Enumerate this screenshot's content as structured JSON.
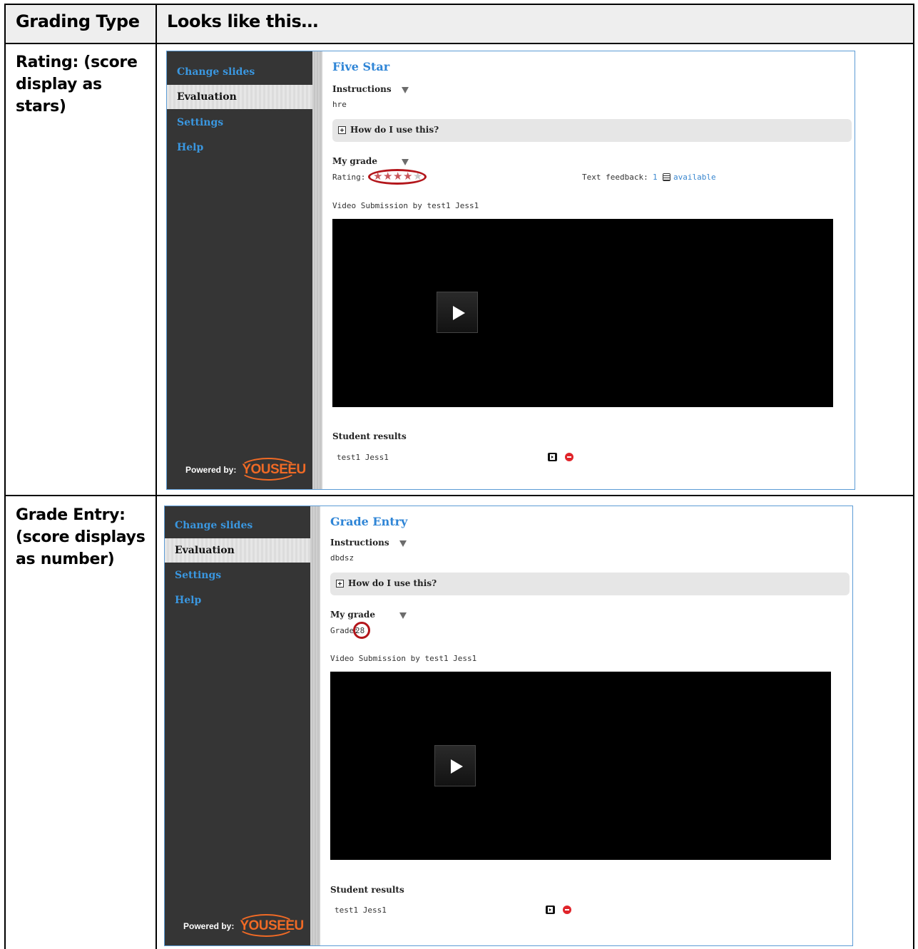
{
  "table": {
    "headers": [
      "Grading Type",
      "Looks like this…"
    ],
    "rows": [
      {
        "label": "Rating: (score display as stars)",
        "app": {
          "sidebar": [
            "Change slides",
            "Evaluation",
            "Settings",
            "Help"
          ],
          "active_index": 1,
          "powered_by": "Powered by:",
          "logo": "YOUSEEU",
          "title": "Five Star",
          "instructions_label": "Instructions",
          "instructions_text": "hre",
          "howto": "How do I use this?",
          "my_grade_label": "My grade",
          "grade_prefix": "Rating:",
          "rating": {
            "filled": 4,
            "max": 5
          },
          "feedback_label": "Text feedback:",
          "feedback_count": "1",
          "feedback_link": "available",
          "video_caption": "Video Submission by test1 Jess1",
          "results_label": "Student results",
          "result_name": "test1 Jess1"
        }
      },
      {
        "label": "Grade Entry: (score displays as number)",
        "app": {
          "sidebar": [
            "Change slides",
            "Evaluation",
            "Settings",
            "Help"
          ],
          "active_index": 1,
          "powered_by": "Powered by:",
          "logo": "YOUSEEU",
          "title": "Grade Entry",
          "instructions_label": "Instructions",
          "instructions_text": "dbdsz",
          "howto": "How do I use this?",
          "my_grade_label": "My grade",
          "grade_prefix": "Grade:",
          "grade_value": "28",
          "video_caption": "Video Submission by test1 Jess1",
          "results_label": "Student results",
          "result_name": "test1 Jess1"
        }
      }
    ]
  },
  "colors": {
    "link_blue": "#2f85d6",
    "sidebar_bg": "#353535",
    "highlight_red": "#b3161b",
    "logo_orange": "#f06a25",
    "star_filled": "#c9565a",
    "star_empty": "#c8c8c8"
  },
  "icons": [
    "plus-box-icon",
    "dropdown-triangle-icon",
    "play-icon",
    "video-result-icon",
    "delete-icon",
    "feedback-list-icon",
    "star-icon"
  ]
}
